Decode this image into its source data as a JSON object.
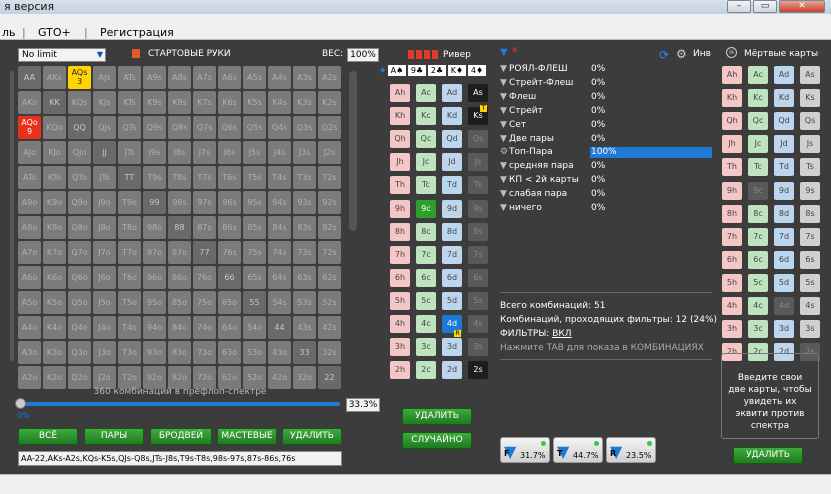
{
  "window": {
    "title": "я версия",
    "minimize": "–",
    "restore": "▭",
    "close": "✕"
  },
  "menu": [
    "ль",
    "GTO+",
    "Регистрация"
  ],
  "range_panel": {
    "mode": "No limit",
    "start_hands": "СТАРТОВЫЕ РУКИ",
    "weight_label": "ВЕС:",
    "weight_value": "100%",
    "combos_text": "360 комбинаций в префлоп-спектре",
    "slider_value": "0%",
    "percent": "33.3%",
    "range_string": "AA-22,AKs-A2s,KQs-K5s,QJs-Q8s,JTs-J8s,T9s-T8s,98s-97s,87s-86s,76s",
    "buttons": [
      "ВСЁ",
      "ПАРЫ",
      "БРОДВЕЙ",
      "МАСТЕВЫЕ",
      "УДАЛИТЬ"
    ]
  },
  "grid": {
    "ranks": [
      "A",
      "K",
      "Q",
      "J",
      "T",
      "9",
      "8",
      "7",
      "6",
      "5",
      "4",
      "3",
      "2"
    ],
    "selected": {
      "row": 0,
      "col": 2,
      "badge": "3"
    },
    "red": {
      "row": 2,
      "col": 0,
      "badge": "9"
    }
  },
  "board_panel": {
    "street": "Ривер",
    "board": [
      "A♠",
      "9♣",
      "2♣",
      "K♦",
      "4♦"
    ],
    "delete": "УДАЛИТЬ",
    "random": "СЛУЧАЙНО",
    "tag_r": "R",
    "tag_t": "T"
  },
  "stats": {
    "header_icon": "Инв",
    "rows": [
      {
        "label": "РОЯЛ-ФЛЕШ",
        "value": "0%"
      },
      {
        "label": "Стрейт-Флеш",
        "value": "0%"
      },
      {
        "label": "Флеш",
        "value": "0%"
      },
      {
        "label": "Стрейт",
        "value": "0%"
      },
      {
        "label": "Сет",
        "value": "0%"
      },
      {
        "label": "Две пары",
        "value": "0%"
      },
      {
        "label": "Топ-Пара",
        "value": "100%"
      },
      {
        "label": "средняя пара",
        "value": "0%"
      },
      {
        "label": "КП < 2й карты",
        "value": "0%"
      },
      {
        "label": "слабая пара",
        "value": "0%"
      },
      {
        "label": "ничего",
        "value": "0%"
      }
    ],
    "total": "Всего комбинаций: 51",
    "passed": "Комбинаций, проходящих фильтры: 12 (24%)",
    "filters_label": "ФИЛЬТРЫ:",
    "filters_state": "ВКЛ",
    "tab_hint": "Нажмите TAB для показа в КОМБИНАЦИЯХ",
    "eq": [
      {
        "letter": "F",
        "value": "31.7%"
      },
      {
        "letter": "T",
        "value": "44.7%"
      },
      {
        "letter": "R",
        "value": "23.5%"
      }
    ]
  },
  "dead_panel": {
    "title": "Мёртвые карты",
    "info": "Введите свои две карты, чтобы увидеть их эквити против спектра",
    "delete": "УДАЛИТЬ"
  },
  "colors": {
    "accent_green": "#2a8f2a",
    "accent_blue": "#1e7ad4",
    "selected_yellow": "#ffd400",
    "red_cell": "#e8301a"
  }
}
